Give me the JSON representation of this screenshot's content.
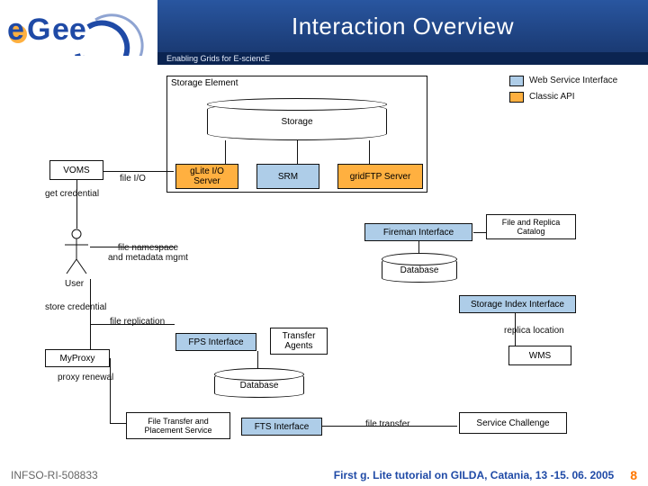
{
  "header": {
    "title": "Interaction Overview",
    "tagline": "Enabling Grids for E-sciencE"
  },
  "footer": {
    "left": "INFSO-RI-508833",
    "center": "First g. Lite tutorial on GILDA, Catania, 13 -15. 06. 2005",
    "page": "8"
  },
  "legend": {
    "web": "Web Service Interface",
    "classic": "Classic API"
  },
  "logo": {
    "text": "eGee"
  },
  "nodes": {
    "storage_element": "Storage Element",
    "storage": "Storage",
    "voms": "VOMS",
    "glite_io": "gLite I/O Server",
    "srm": "SRM",
    "gridftp": "gridFTP Server",
    "fireman": "Fireman Interface",
    "file_replica": "File and Replica Catalog",
    "db1": "Database",
    "storage_index": "Storage Index Interface",
    "fps": "FPS Interface",
    "transfer_agents": "Transfer Agents",
    "wms": "WMS",
    "myproxy": "MyProxy",
    "db2": "Database",
    "file_transfer_service": "File Transfer and Placement Service",
    "fts_if": "FTS Interface",
    "service_challenge": "Service Challenge",
    "user": "User"
  },
  "edge_labels": {
    "get_credential": "get credential",
    "file_io": "file I/O",
    "file_ns": "file namespace\nand metadata mgmt",
    "file_replication": "file replication",
    "store_credential": "store credential",
    "proxy_renewal": "proxy renewal",
    "file_transfer": "file transfer",
    "replica_location": "replica location"
  }
}
